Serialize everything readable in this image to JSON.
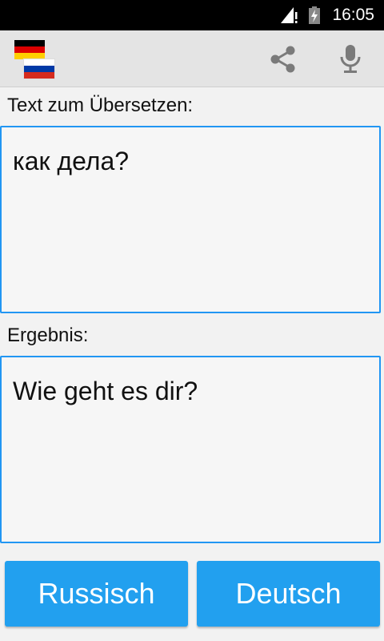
{
  "status_bar": {
    "time": "16:05"
  },
  "toolbar": {
    "source_flag": "german-flag",
    "target_flag": "russian-flag",
    "share_icon": "share-icon",
    "mic_icon": "microphone-icon"
  },
  "source": {
    "label": "Text zum Übersetzen:",
    "text": "как дела?"
  },
  "result": {
    "label": "Ergebnis:",
    "text": "Wie geht es dir?"
  },
  "buttons": {
    "from_language": "Russisch",
    "to_language": "Deutsch"
  },
  "colors": {
    "accent": "#2196f3",
    "button": "#22a0ef"
  }
}
